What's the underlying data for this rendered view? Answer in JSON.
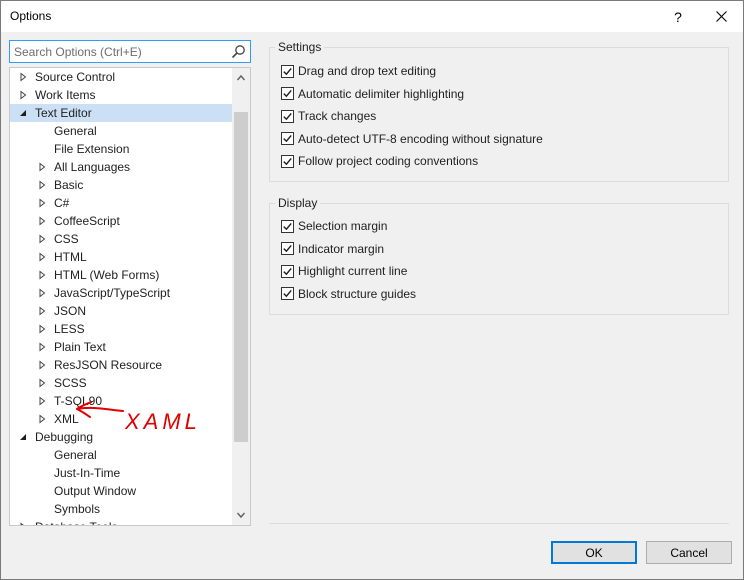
{
  "window": {
    "title": "Options",
    "help_glyph": "?",
    "close_icon": "close-icon"
  },
  "search": {
    "placeholder": "Search Options (Ctrl+E)",
    "value": "",
    "icon": "search-icon"
  },
  "tree": {
    "nodes": [
      {
        "label": "Source Control",
        "level": 0,
        "state": "collapsed"
      },
      {
        "label": "Work Items",
        "level": 0,
        "state": "collapsed"
      },
      {
        "label": "Text Editor",
        "level": 0,
        "state": "expanded",
        "selected": true
      },
      {
        "label": "General",
        "level": 1,
        "state": "leaf"
      },
      {
        "label": "File Extension",
        "level": 1,
        "state": "leaf"
      },
      {
        "label": "All Languages",
        "level": 1,
        "state": "collapsed"
      },
      {
        "label": "Basic",
        "level": 1,
        "state": "collapsed"
      },
      {
        "label": "C#",
        "level": 1,
        "state": "collapsed"
      },
      {
        "label": "CoffeeScript",
        "level": 1,
        "state": "collapsed"
      },
      {
        "label": "CSS",
        "level": 1,
        "state": "collapsed"
      },
      {
        "label": "HTML",
        "level": 1,
        "state": "collapsed"
      },
      {
        "label": "HTML (Web Forms)",
        "level": 1,
        "state": "collapsed"
      },
      {
        "label": "JavaScript/TypeScript",
        "level": 1,
        "state": "collapsed"
      },
      {
        "label": "JSON",
        "level": 1,
        "state": "collapsed"
      },
      {
        "label": "LESS",
        "level": 1,
        "state": "collapsed"
      },
      {
        "label": "Plain Text",
        "level": 1,
        "state": "collapsed"
      },
      {
        "label": "ResJSON Resource",
        "level": 1,
        "state": "collapsed"
      },
      {
        "label": "SCSS",
        "level": 1,
        "state": "collapsed"
      },
      {
        "label": "T-SQL90",
        "level": 1,
        "state": "collapsed"
      },
      {
        "label": "XML",
        "level": 1,
        "state": "collapsed"
      },
      {
        "label": "Debugging",
        "level": 0,
        "state": "expanded"
      },
      {
        "label": "General",
        "level": 1,
        "state": "leaf"
      },
      {
        "label": "Just-In-Time",
        "level": 1,
        "state": "leaf"
      },
      {
        "label": "Output Window",
        "level": 1,
        "state": "leaf"
      },
      {
        "label": "Symbols",
        "level": 1,
        "state": "leaf"
      },
      {
        "label": "Database Tools",
        "level": 0,
        "state": "collapsed"
      }
    ]
  },
  "settings": {
    "title": "Settings",
    "options": [
      {
        "label": "Drag and drop text editing",
        "checked": true
      },
      {
        "label": "Automatic delimiter highlighting",
        "checked": true
      },
      {
        "label": "Track changes",
        "checked": true
      },
      {
        "label": "Auto-detect UTF-8 encoding without signature",
        "checked": true
      },
      {
        "label": "Follow project coding conventions",
        "checked": true
      }
    ]
  },
  "display": {
    "title": "Display",
    "options": [
      {
        "label": "Selection margin",
        "checked": true
      },
      {
        "label": "Indicator margin",
        "checked": true
      },
      {
        "label": "Highlight current line",
        "checked": true
      },
      {
        "label": "Block structure guides",
        "checked": true
      }
    ]
  },
  "buttons": {
    "ok": "OK",
    "cancel": "Cancel"
  },
  "annotation": {
    "text": "XAML",
    "color": "#e00000"
  },
  "colors": {
    "selection": "#cce0f5",
    "focus_border": "#3399ff",
    "default_button_border": "#0078d7"
  }
}
